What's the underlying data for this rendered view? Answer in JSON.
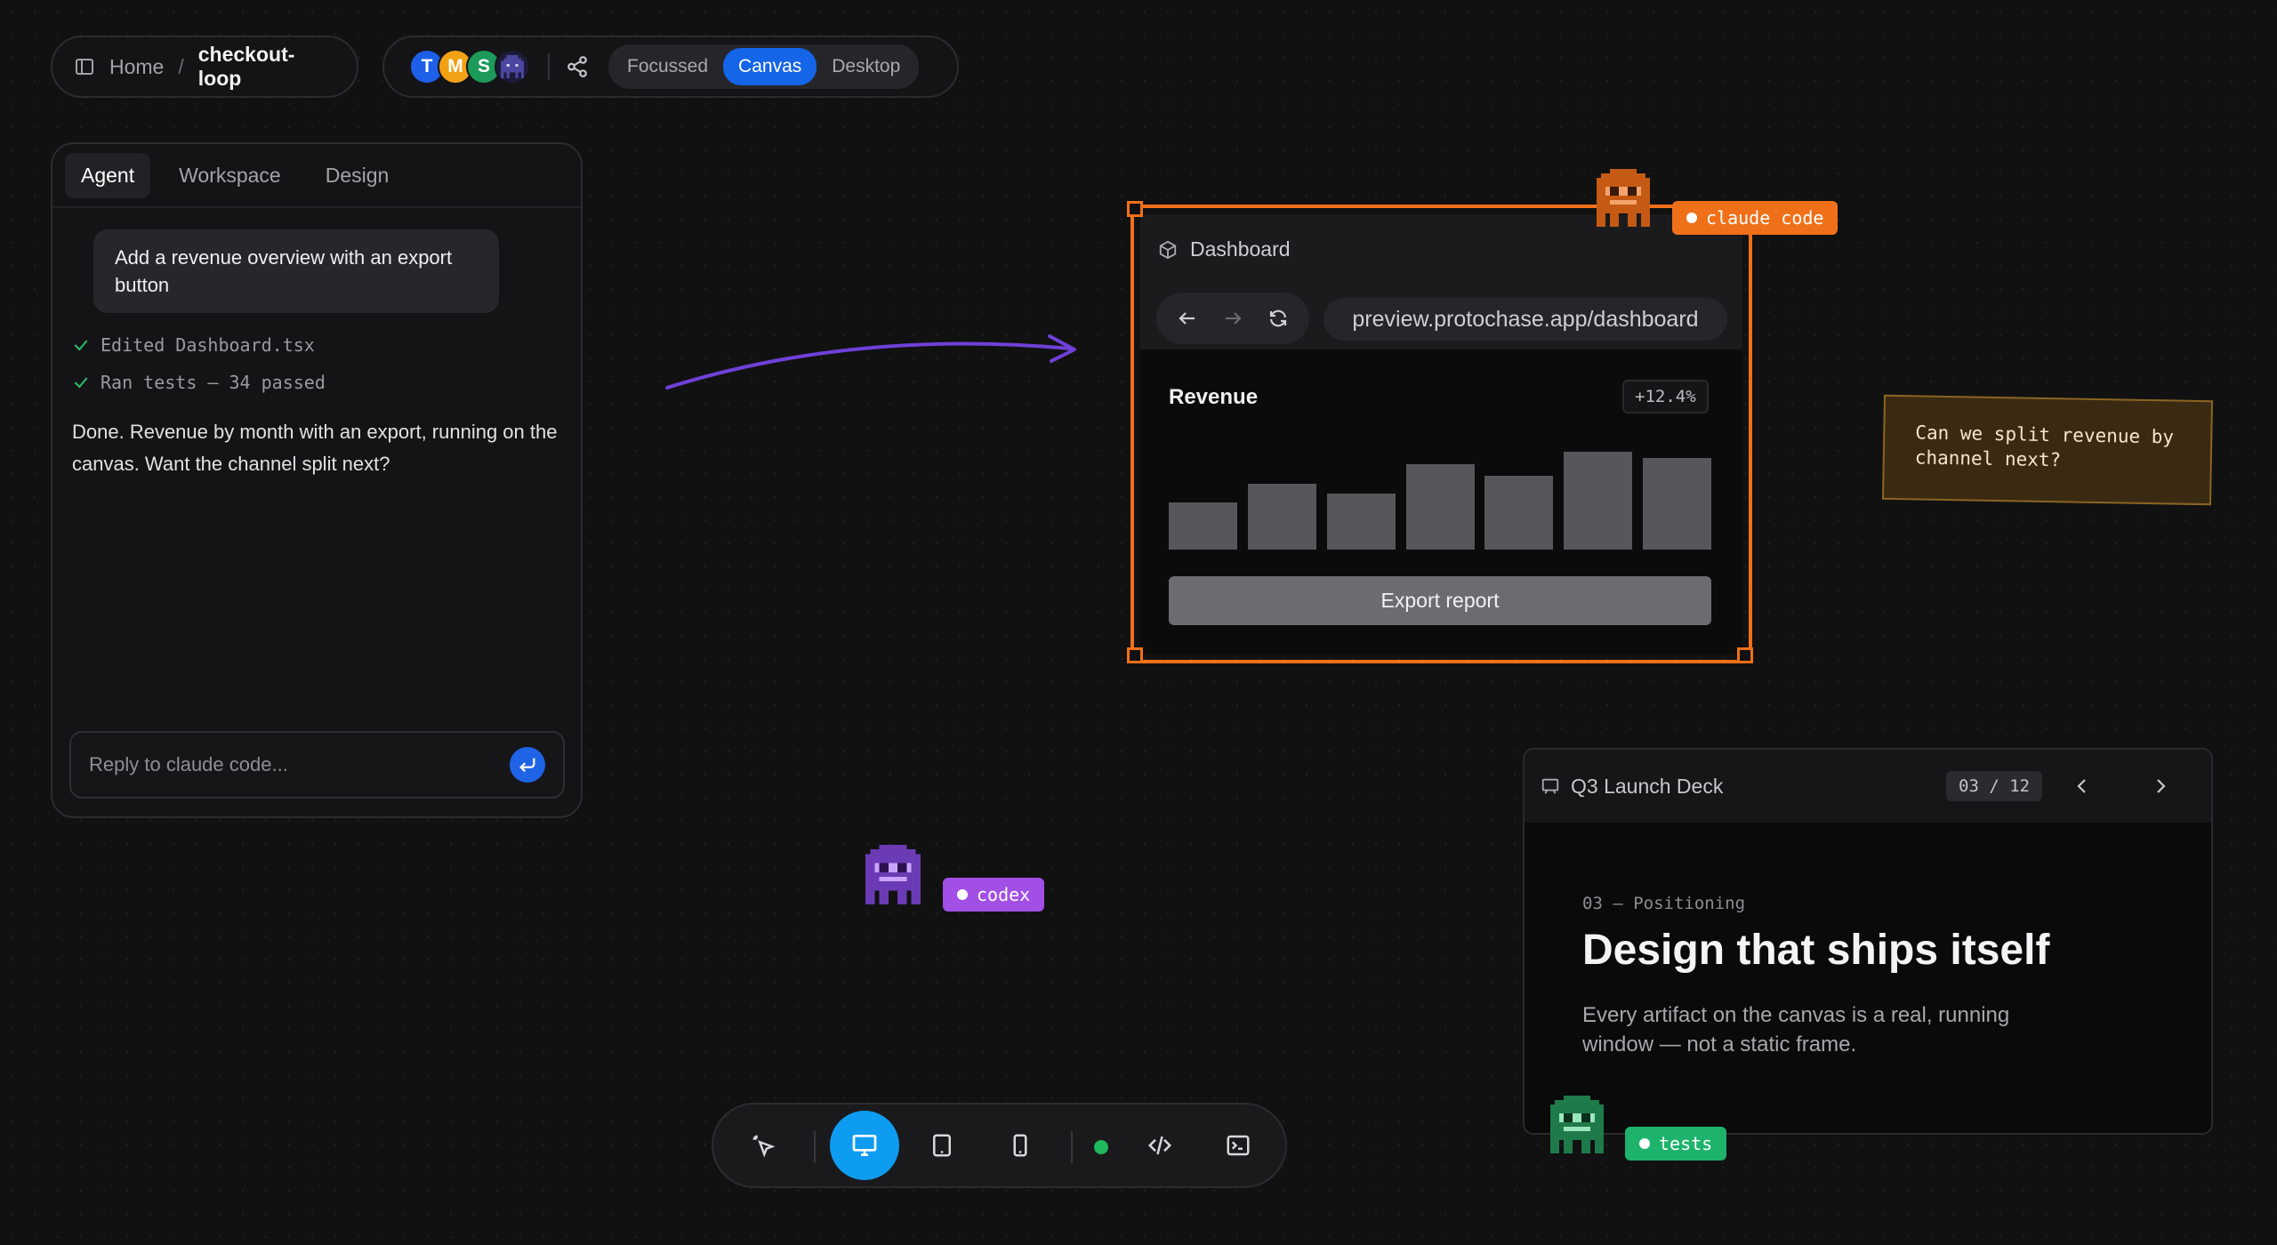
{
  "breadcrumb": {
    "home": "Home",
    "separator": "/",
    "project": "checkout-loop"
  },
  "presence": {
    "avatars": [
      {
        "initial": "T",
        "color": "#1d5fe8"
      },
      {
        "initial": "M",
        "color": "#f2a115"
      },
      {
        "initial": "S",
        "color": "#1c9a5a"
      }
    ],
    "view_modes": [
      "Focussed",
      "Canvas",
      "Desktop"
    ],
    "active_view": "Canvas"
  },
  "chat": {
    "tabs": [
      "Agent",
      "Workspace",
      "Design"
    ],
    "active_tab": "Agent",
    "user_message": "Add a revenue overview with an export button",
    "log": [
      "Edited Dashboard.tsx",
      "Ran tests — 34 passed"
    ],
    "reply": "Done. Revenue by month with an export, running on the canvas. Want the channel split next?",
    "input_placeholder": "Reply to claude code..."
  },
  "dashboard": {
    "title": "Dashboard",
    "url": "preview.protochase.app/dashboard",
    "card_title": "Revenue",
    "delta": "+12.4%",
    "bars": [
      0.48,
      0.67,
      0.57,
      0.87,
      0.75,
      1.0,
      0.94
    ],
    "export_label": "Export report"
  },
  "agents": {
    "claude": {
      "label": "claude code",
      "color": "#f07019"
    },
    "codex": {
      "label": "codex",
      "color": "#a24fe6"
    },
    "tests": {
      "label": "tests",
      "color": "#1db36b"
    }
  },
  "note": {
    "text": "Can we split revenue by channel next?"
  },
  "deck": {
    "title": "Q3 Launch Deck",
    "pager": "03 / 12",
    "kicker": "03 — Positioning",
    "headline": "Design that ships itself",
    "body": "Every artifact on the canvas is a real, running window — not a static frame."
  },
  "colors": {
    "accent": "#1565e8",
    "selection": "#f07019",
    "arrow": "#7040d8",
    "device_active": "#0e9cf0",
    "live_dot": "#1fb85c"
  }
}
